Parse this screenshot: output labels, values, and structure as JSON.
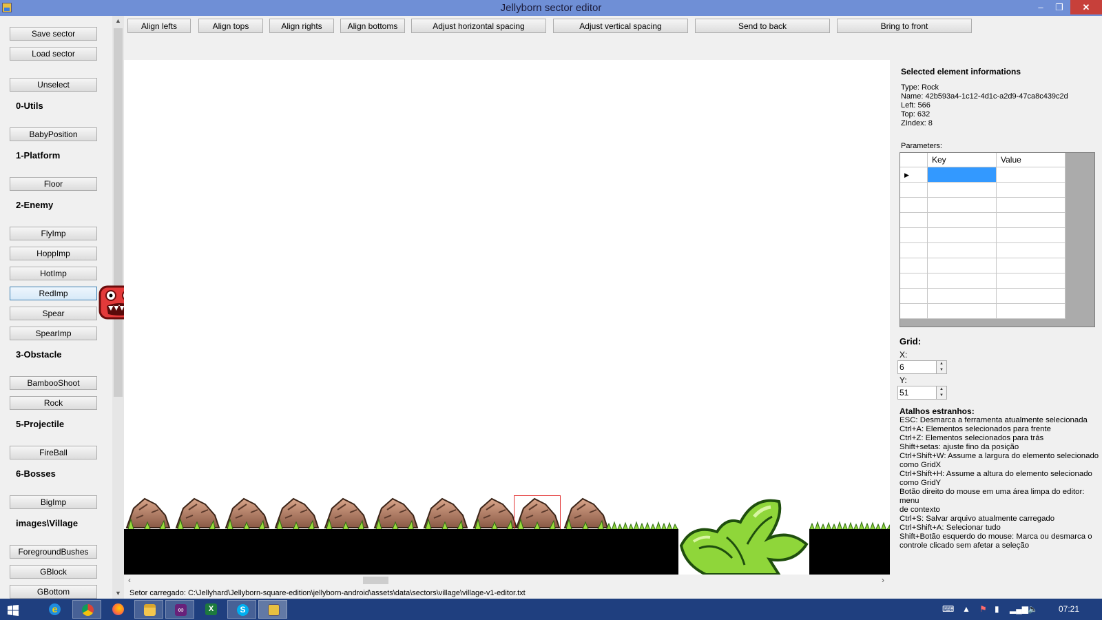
{
  "window": {
    "title": "Jellyborn sector editor",
    "minimize_glyph": "–",
    "maximize_glyph": "❐",
    "close_glyph": "✕"
  },
  "sidebar": {
    "save_label": "Save sector",
    "load_label": "Load sector",
    "unselect_label": "Unselect",
    "categories": [
      {
        "title": "0-Utils",
        "items": [
          "BabyPosition"
        ]
      },
      {
        "title": "1-Platform",
        "items": [
          "Floor"
        ]
      },
      {
        "title": "2-Enemy",
        "items": [
          "FlyImp",
          "HoppImp",
          "HotImp",
          "RedImp",
          "Spear",
          "SpearImp"
        ]
      },
      {
        "title": "3-Obstacle",
        "items": [
          "BambooShoot",
          "Rock"
        ]
      },
      {
        "title": "5-Projectile",
        "items": [
          "FireBall"
        ]
      },
      {
        "title": "6-Bosses",
        "items": [
          "BigImp"
        ]
      },
      {
        "title": "images\\Village",
        "items": [
          "ForegroundBushes",
          "GBlock",
          "GBottom"
        ]
      }
    ]
  },
  "toolbar": {
    "buttons": [
      "Align lefts",
      "Align tops",
      "Align rights",
      "Align bottoms",
      "Adjust horizontal spacing",
      "Adjust vertical spacing",
      "Send to back",
      "Bring to front"
    ]
  },
  "selected": {
    "heading": "Selected element informations",
    "type": "Type: Rock",
    "name": "Name: 42b593a4-1c12-4d1c-a2d9-47ca8c439c2d",
    "left": "Left: 566",
    "top": "Top: 632",
    "zindex": "ZIndex: 8",
    "parameters_label": "Parameters:",
    "columns": [
      "Key",
      "Value"
    ],
    "row_marker": "▶"
  },
  "grid": {
    "heading": "Grid:",
    "x_label": "X:",
    "x_value": "6",
    "y_label": "Y:",
    "y_value": "51"
  },
  "shortcuts": {
    "heading": "Atalhos estranhos:",
    "lines": [
      "ESC: Desmarca a ferramenta atualmente selecionada",
      "Ctrl+A: Elementos selecionados para frente",
      "Ctrl+Z: Elementos selecionados para trás",
      "Shift+setas: ajuste fino da posição",
      "Ctrl+Shift+W: Assume a largura do elemento selecionado",
      "como GridX",
      "Ctrl+Shift+H: Assume a altura do elemento selecionado",
      "como GridY",
      "Botão direito do mouse em uma área limpa do editor: menu",
      "de contexto",
      "Ctrl+S: Salvar arquivo atualmente carregado",
      "Ctrl+Shift+A: Selecionar tudo",
      "Shift+Botão esquerdo do mouse: Marca ou desmarca o",
      "controle clicado sem afetar a seleção"
    ]
  },
  "status": {
    "text": "Setor carregado: C:\\Jellyhard\\Jellyborn-square-edition\\jellyborn-android\\assets\\data\\sectors\\village\\village-v1-editor.txt"
  },
  "taskbar": {
    "clock": "07:21",
    "apps": [
      "windows-start",
      "internet-explorer",
      "chrome",
      "firefox",
      "file-explorer",
      "visual-studio",
      "excel",
      "skype",
      "jellyborn-editor"
    ]
  },
  "colors": {
    "titlebar": "#6f8fd6",
    "taskbar": "#1f3f7f",
    "selection": "#3399ff",
    "selection_box": "#e23030"
  }
}
